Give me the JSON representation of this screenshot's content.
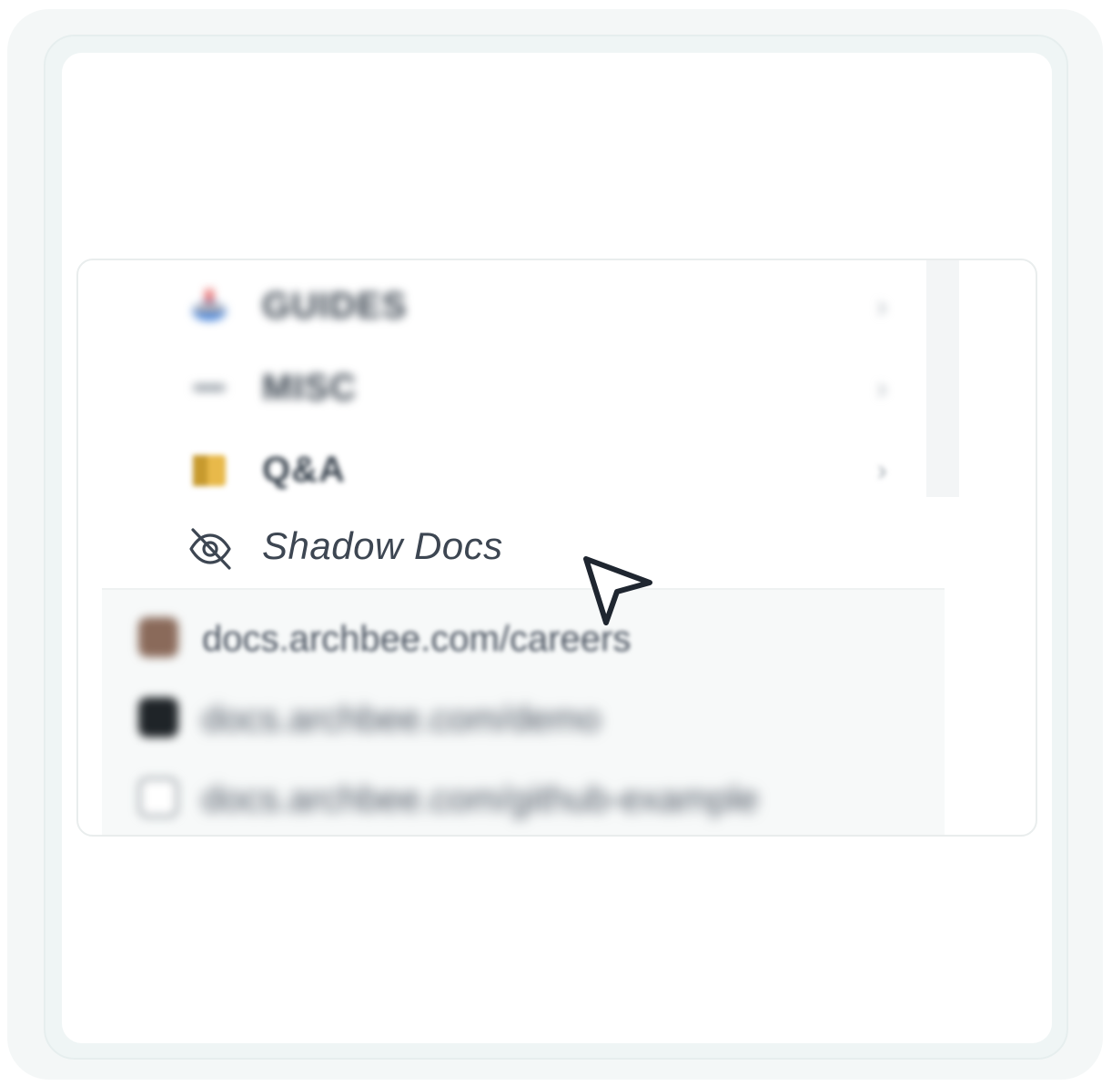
{
  "sidebar": {
    "items": [
      {
        "label": "GUIDES",
        "icon": "compass-emoji-icon",
        "has_chevron": true
      },
      {
        "label": "MISC",
        "icon": "dash-icon",
        "has_chevron": true
      },
      {
        "label": "Q&A",
        "icon": "folder-emoji-icon",
        "has_chevron": true
      }
    ],
    "shadow_item": {
      "label": "Shadow Docs",
      "icon": "eye-off-icon"
    }
  },
  "links": [
    {
      "text": "docs.archbee.com/careers",
      "icon": "briefcase-icon"
    },
    {
      "text": "docs.archbee.com/demo",
      "icon": "dark-square-icon"
    },
    {
      "text": "docs.archbee.com/github-example",
      "icon": "tablet-icon"
    }
  ],
  "colors": {
    "frame_outer": "#f4f7f7",
    "frame_mid": "#eff5f5",
    "text_primary": "#3d4652",
    "links_background": "#f7f9f9"
  }
}
